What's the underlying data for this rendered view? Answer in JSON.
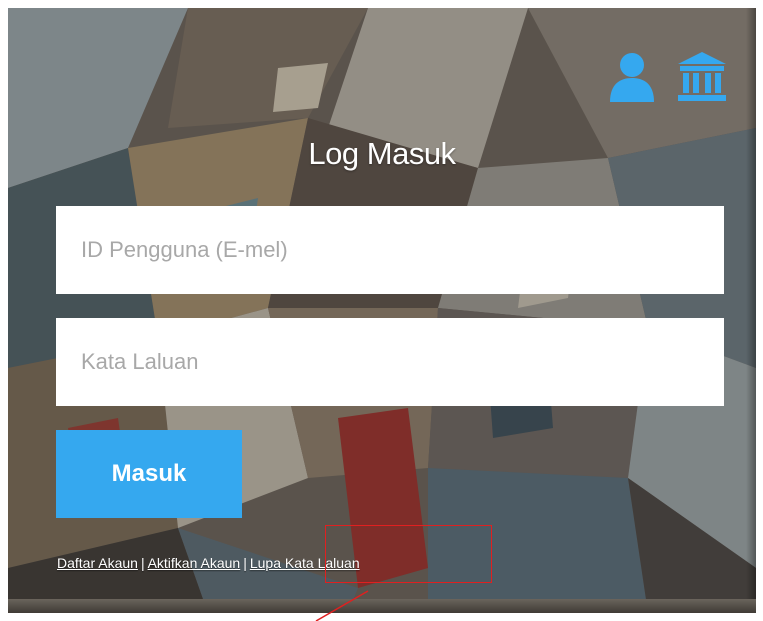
{
  "login": {
    "title": "Log Masuk",
    "user_id_placeholder": "ID Pengguna (E-mel)",
    "password_placeholder": "Kata Laluan",
    "submit_label": "Masuk"
  },
  "icons": {
    "user": "user-icon",
    "institution": "institution-icon"
  },
  "links": {
    "register_label": "Daftar Akaun",
    "activate_label": "Aktifkan Akaun",
    "forgot_label": "Lupa Kata Laluan",
    "separator": "|"
  },
  "colors": {
    "accent": "#35a8ef",
    "annotation": "#e02020"
  }
}
